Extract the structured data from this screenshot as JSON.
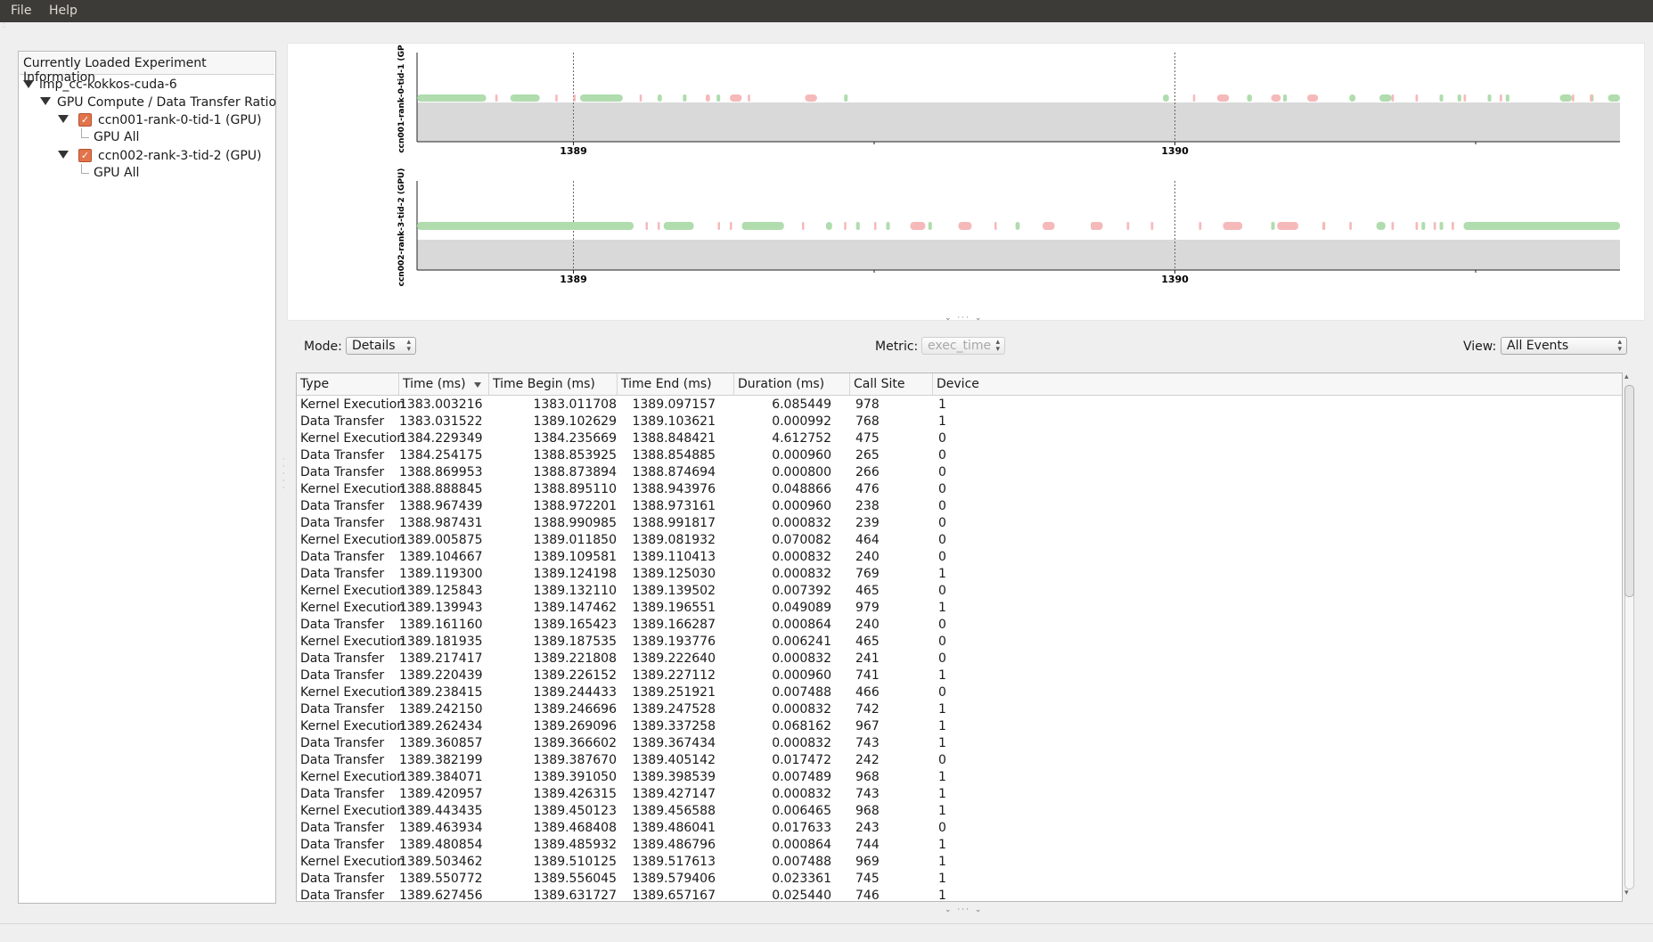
{
  "menu": {
    "file": "File",
    "help": "Help"
  },
  "tree": {
    "header": "Currently Loaded Experiment Information",
    "experiment": "lmp_cc-kokkos-cuda-6",
    "view": "GPU Compute / Data Transfer Ratio",
    "threads": [
      {
        "label": "ccn001-rank-0-tid-1 (GPU)",
        "child": "GPU All"
      },
      {
        "label": "ccn002-rank-3-tid-2 (GPU)",
        "child": "GPU All"
      }
    ]
  },
  "graphs": {
    "colors": {
      "kernel": "#b0dcae",
      "transfer": "#f6b9b9",
      "band": "#d9d9d9"
    },
    "axis_range": [
      1388.74,
      1390.74
    ],
    "ticks": [
      1389,
      1390
    ],
    "tracks": [
      {
        "label": "ccn001-rank-0-tid-1 (GP",
        "kernel": [
          [
            1388.74,
            1388.855
          ],
          [
            1388.895,
            1388.944
          ],
          [
            1389.011,
            1389.082
          ],
          [
            1389.14,
            1389.147
          ],
          [
            1389.182,
            1389.188
          ],
          [
            1389.238,
            1389.244
          ],
          [
            1389.45,
            1389.456
          ],
          [
            1389.98,
            1389.99
          ],
          [
            1390.12,
            1390.128
          ],
          [
            1390.18,
            1390.186
          ],
          [
            1390.29,
            1390.3
          ],
          [
            1390.34,
            1390.36
          ],
          [
            1390.44,
            1390.446
          ],
          [
            1390.47,
            1390.476
          ],
          [
            1390.52,
            1390.526
          ],
          [
            1390.55,
            1390.556
          ],
          [
            1390.64,
            1390.66
          ],
          [
            1390.69,
            1390.696
          ],
          [
            1390.72,
            1390.74
          ]
        ],
        "transfer": [
          [
            1388.87,
            1388.874
          ],
          [
            1388.97,
            1388.973
          ],
          [
            1389.0,
            1389.003
          ],
          [
            1389.11,
            1389.113
          ],
          [
            1389.22,
            1389.227
          ],
          [
            1389.29,
            1389.293
          ],
          [
            1389.26,
            1389.28
          ],
          [
            1389.385,
            1389.405
          ],
          [
            1390.03,
            1390.033
          ],
          [
            1390.07,
            1390.09
          ],
          [
            1390.16,
            1390.176
          ],
          [
            1390.22,
            1390.238
          ],
          [
            1390.36,
            1390.364
          ],
          [
            1390.4,
            1390.404
          ],
          [
            1390.48,
            1390.484
          ],
          [
            1390.54,
            1390.544
          ],
          [
            1390.66,
            1390.664
          ],
          [
            1390.69,
            1390.694
          ]
        ]
      },
      {
        "label": "ccn002-rank-3-tid-2 (GPU)",
        "kernel": [
          [
            1388.74,
            1389.1
          ],
          [
            1389.15,
            1389.2
          ],
          [
            1389.28,
            1389.35
          ],
          [
            1389.42,
            1389.43
          ],
          [
            1389.47,
            1389.476
          ],
          [
            1389.52,
            1389.526
          ],
          [
            1389.59,
            1389.596
          ],
          [
            1389.735,
            1389.742
          ],
          [
            1389.86,
            1389.868
          ],
          [
            1390.16,
            1390.166
          ],
          [
            1390.335,
            1390.35
          ],
          [
            1390.41,
            1390.416
          ],
          [
            1390.44,
            1390.446
          ],
          [
            1390.48,
            1390.74
          ]
        ],
        "transfer": [
          [
            1389.12,
            1389.123
          ],
          [
            1389.14,
            1389.143
          ],
          [
            1389.24,
            1389.243
          ],
          [
            1389.26,
            1389.263
          ],
          [
            1389.38,
            1389.383
          ],
          [
            1389.45,
            1389.453
          ],
          [
            1389.5,
            1389.503
          ],
          [
            1389.56,
            1389.585
          ],
          [
            1389.64,
            1389.662
          ],
          [
            1389.7,
            1389.703
          ],
          [
            1389.78,
            1389.8
          ],
          [
            1389.86,
            1389.88
          ],
          [
            1389.92,
            1389.924
          ],
          [
            1389.96,
            1389.964
          ],
          [
            1390.04,
            1390.044
          ],
          [
            1390.08,
            1390.112
          ],
          [
            1390.17,
            1390.205
          ],
          [
            1390.245,
            1390.25
          ],
          [
            1390.29,
            1390.294
          ],
          [
            1390.36,
            1390.364
          ],
          [
            1390.4,
            1390.404
          ],
          [
            1390.43,
            1390.434
          ],
          [
            1390.46,
            1390.464
          ]
        ]
      }
    ]
  },
  "controls": {
    "mode_label": "Mode:",
    "mode_value": "Details",
    "metric_label": "Metric:",
    "metric_value": "exec_time",
    "view_label": "View:",
    "view_value": "All Events"
  },
  "table": {
    "columns": [
      "Type",
      "Time (ms)",
      "Time Begin (ms)",
      "Time End (ms)",
      "Duration (ms)",
      "Call Site",
      "Device"
    ],
    "rows": [
      [
        "Kernel Execution",
        "1383.003216",
        "1383.011708",
        "1389.097157",
        "6.085449",
        "978",
        "1"
      ],
      [
        "Data Transfer",
        "1383.031522",
        "1389.102629",
        "1389.103621",
        "0.000992",
        "768",
        "1"
      ],
      [
        "Kernel Execution",
        "1384.229349",
        "1384.235669",
        "1388.848421",
        "4.612752",
        "475",
        "0"
      ],
      [
        "Data Transfer",
        "1384.254175",
        "1388.853925",
        "1388.854885",
        "0.000960",
        "265",
        "0"
      ],
      [
        "Data Transfer",
        "1388.869953",
        "1388.873894",
        "1388.874694",
        "0.000800",
        "266",
        "0"
      ],
      [
        "Kernel Execution",
        "1388.888845",
        "1388.895110",
        "1388.943976",
        "0.048866",
        "476",
        "0"
      ],
      [
        "Data Transfer",
        "1388.967439",
        "1388.972201",
        "1388.973161",
        "0.000960",
        "238",
        "0"
      ],
      [
        "Data Transfer",
        "1388.987431",
        "1388.990985",
        "1388.991817",
        "0.000832",
        "239",
        "0"
      ],
      [
        "Kernel Execution",
        "1389.005875",
        "1389.011850",
        "1389.081932",
        "0.070082",
        "464",
        "0"
      ],
      [
        "Data Transfer",
        "1389.104667",
        "1389.109581",
        "1389.110413",
        "0.000832",
        "240",
        "0"
      ],
      [
        "Data Transfer",
        "1389.119300",
        "1389.124198",
        "1389.125030",
        "0.000832",
        "769",
        "1"
      ],
      [
        "Kernel Execution",
        "1389.125843",
        "1389.132110",
        "1389.139502",
        "0.007392",
        "465",
        "0"
      ],
      [
        "Kernel Execution",
        "1389.139943",
        "1389.147462",
        "1389.196551",
        "0.049089",
        "979",
        "1"
      ],
      [
        "Data Transfer",
        "1389.161160",
        "1389.165423",
        "1389.166287",
        "0.000864",
        "240",
        "0"
      ],
      [
        "Kernel Execution",
        "1389.181935",
        "1389.187535",
        "1389.193776",
        "0.006241",
        "465",
        "0"
      ],
      [
        "Data Transfer",
        "1389.217417",
        "1389.221808",
        "1389.222640",
        "0.000832",
        "241",
        "0"
      ],
      [
        "Data Transfer",
        "1389.220439",
        "1389.226152",
        "1389.227112",
        "0.000960",
        "741",
        "1"
      ],
      [
        "Kernel Execution",
        "1389.238415",
        "1389.244433",
        "1389.251921",
        "0.007488",
        "466",
        "0"
      ],
      [
        "Data Transfer",
        "1389.242150",
        "1389.246696",
        "1389.247528",
        "0.000832",
        "742",
        "1"
      ],
      [
        "Kernel Execution",
        "1389.262434",
        "1389.269096",
        "1389.337258",
        "0.068162",
        "967",
        "1"
      ],
      [
        "Data Transfer",
        "1389.360857",
        "1389.366602",
        "1389.367434",
        "0.000832",
        "743",
        "1"
      ],
      [
        "Data Transfer",
        "1389.382199",
        "1389.387670",
        "1389.405142",
        "0.017472",
        "242",
        "0"
      ],
      [
        "Kernel Execution",
        "1389.384071",
        "1389.391050",
        "1389.398539",
        "0.007489",
        "968",
        "1"
      ],
      [
        "Data Transfer",
        "1389.420957",
        "1389.426315",
        "1389.427147",
        "0.000832",
        "743",
        "1"
      ],
      [
        "Kernel Execution",
        "1389.443435",
        "1389.450123",
        "1389.456588",
        "0.006465",
        "968",
        "1"
      ],
      [
        "Data Transfer",
        "1389.463934",
        "1389.468408",
        "1389.486041",
        "0.017633",
        "243",
        "0"
      ],
      [
        "Data Transfer",
        "1389.480854",
        "1389.485932",
        "1389.486796",
        "0.000864",
        "744",
        "1"
      ],
      [
        "Kernel Execution",
        "1389.503462",
        "1389.510125",
        "1389.517613",
        "0.007488",
        "969",
        "1"
      ],
      [
        "Data Transfer",
        "1389.550772",
        "1389.556045",
        "1389.579406",
        "0.023361",
        "745",
        "1"
      ],
      [
        "Data Transfer",
        "1389.627456",
        "1389.631727",
        "1389.657167",
        "0.025440",
        "746",
        "1"
      ]
    ]
  }
}
